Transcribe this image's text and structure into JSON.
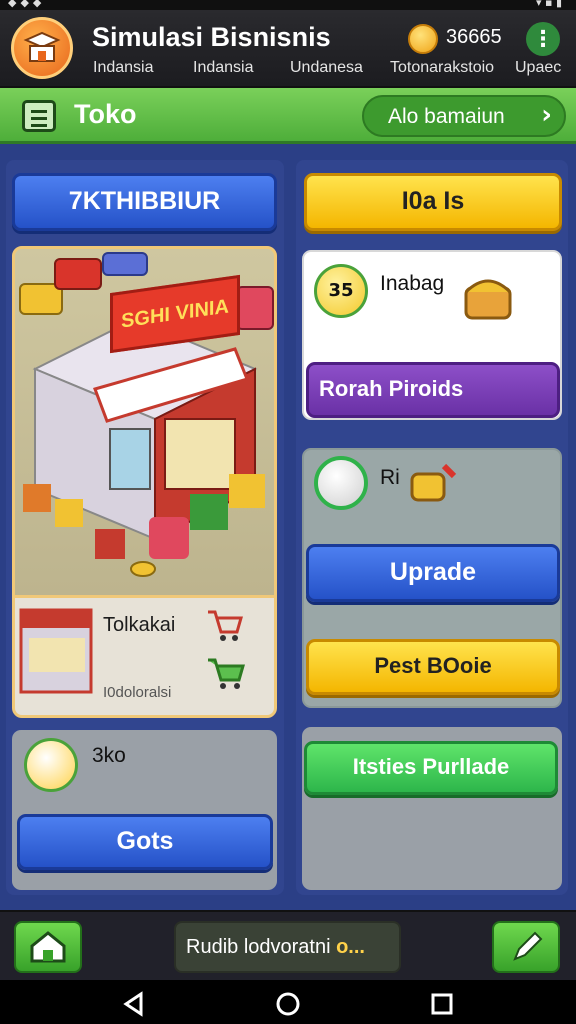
{
  "header": {
    "title": "Simulasi Bisnisnis",
    "subtitles": [
      "Indansia",
      "Indansia",
      "Undanesa"
    ],
    "coins": "36665",
    "coins_caption": "Totonarakstoio",
    "upgrade_caption": "Upaec",
    "menu_glyph": "⋮"
  },
  "tab": {
    "title": "Toko",
    "action_label": "Alo bamaiun",
    "action_glyph": "›"
  },
  "left_column": {
    "top_button": "7KTHIBBIUR",
    "shop_sign": "SGHI VINIA",
    "shop_name": "Tolkakai",
    "shop_sub": "I0doloralsi",
    "card_title": "3ko",
    "card_button": "Gots"
  },
  "right_column": {
    "top_button": "I0a Is",
    "card1_title": "Inabag",
    "card1_badge": "35",
    "card1_button": "Rorah Piroids",
    "card2_title": "Ri",
    "card2_button": "Uprade",
    "card2_button2": "Pest BOoie",
    "card3_button": "Itsties Purllade"
  },
  "bottom": {
    "status_text": "Rudib lodvoratni",
    "status_suffix": "o..."
  },
  "colors": {
    "background": "#2b3f86",
    "accent_green": "#4eae3a",
    "button_blue": "#2552c8",
    "button_yellow": "#f4b600"
  }
}
